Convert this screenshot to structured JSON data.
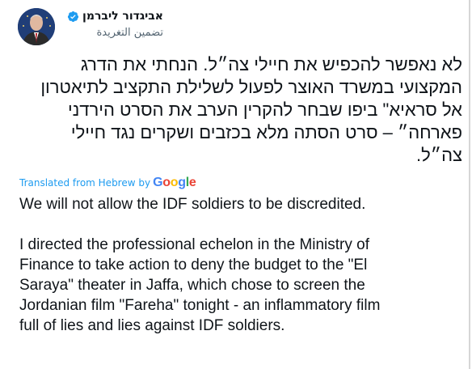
{
  "tweet": {
    "author_name": "אביגדור ליברמן",
    "subtitle": "تضمين التغريدة",
    "hebrew_lines": [
      "לא נאפשר להכפיש את חיילי צה״ל. הנחתי את הדרג",
      "המקצועי במשרד האוצר לפעול לשלילת התקציב לתיאטרון",
      "אל סראיא\" ביפו שבחר להקרין הערב את הסרט הירדני",
      "פארחה״ – סרט הסתה מלא בכזבים ושקרים נגד חיילי",
      "צה״ל."
    ],
    "translated_label": "Translated from Hebrew by",
    "translator_logo": "Google",
    "english_first": "We will not allow the IDF soldiers to be discredited.",
    "english_lines": [
      "I directed the professional echelon in the Ministry of",
      "Finance to take action to deny the budget to the \"El",
      "Saraya\" theater in Jaffa, which chose to screen the",
      "Jordanian film \"Fareha\" tonight - an inflammatory film",
      "full of lies and lies against IDF soldiers."
    ]
  },
  "icons": {
    "verified": "verified-badge-icon"
  },
  "colors": {
    "link": "#1d9bf0",
    "text": "#0f1419",
    "muted": "#536471",
    "google_blue": "#4285F4",
    "google_red": "#EA4335",
    "google_yellow": "#FBBC05",
    "google_green": "#34A853"
  }
}
